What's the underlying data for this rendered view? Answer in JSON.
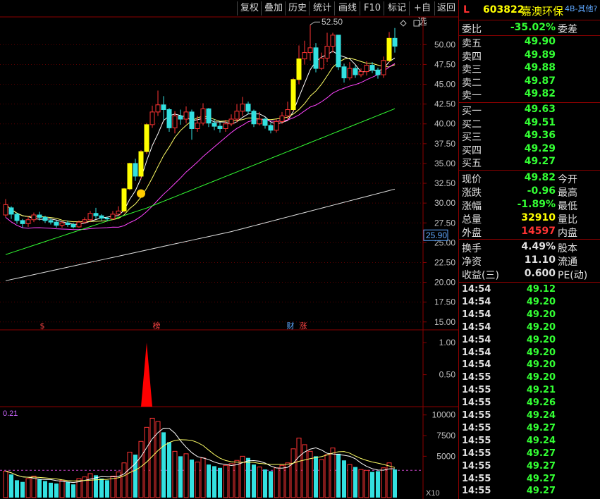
{
  "toolbar": {
    "buttons": [
      "复权",
      "叠加",
      "历史",
      "统计",
      "画线",
      "F10",
      "标记",
      "+自选",
      "返回"
    ]
  },
  "quote_header": {
    "flag": "L",
    "code": "603822",
    "name": "嘉澳环保",
    "other": "4B-其他?"
  },
  "order_book": {
    "weibi_label": "委比",
    "weibi_value": "-35.02%",
    "weicha_label": "委差",
    "asks": [
      {
        "label": "卖五",
        "price": "49.90"
      },
      {
        "label": "卖四",
        "price": "49.89"
      },
      {
        "label": "卖三",
        "price": "49.88"
      },
      {
        "label": "卖二",
        "price": "49.87"
      },
      {
        "label": "卖一",
        "price": "49.82"
      }
    ],
    "bids": [
      {
        "label": "买一",
        "price": "49.63"
      },
      {
        "label": "买二",
        "price": "49.51"
      },
      {
        "label": "买三",
        "price": "49.36"
      },
      {
        "label": "买四",
        "price": "49.29"
      },
      {
        "label": "买五",
        "price": "49.27"
      }
    ]
  },
  "stats": [
    {
      "label": "现价",
      "value": "49.82",
      "color": "#33ff33",
      "label2": "今开"
    },
    {
      "label": "涨跌",
      "value": "-0.96",
      "color": "#33ff33",
      "label2": "最高"
    },
    {
      "label": "涨幅",
      "value": "-1.89%",
      "color": "#33ff33",
      "label2": "最低"
    },
    {
      "label": "总量",
      "value": "32910",
      "color": "#ffff00",
      "label2": "量比"
    },
    {
      "label": "外盘",
      "value": "14597",
      "color": "#ff3333",
      "label2": "内盘"
    }
  ],
  "finance": [
    {
      "label": "换手",
      "value": "4.49%",
      "label2": "股本"
    },
    {
      "label": "净资",
      "value": "11.10",
      "label2": "流通"
    },
    {
      "label": "收益(三)",
      "value": "0.600",
      "label2": "PE(动)"
    }
  ],
  "ticks": [
    {
      "time": "14:54",
      "price": "49.12"
    },
    {
      "time": "14:54",
      "price": "49.20"
    },
    {
      "time": "14:54",
      "price": "49.20"
    },
    {
      "time": "14:54",
      "price": "49.20"
    },
    {
      "time": "14:54",
      "price": "49.20"
    },
    {
      "time": "14:54",
      "price": "49.20"
    },
    {
      "time": "14:54",
      "price": "49.20"
    },
    {
      "time": "14:55",
      "price": "49.20"
    },
    {
      "time": "14:55",
      "price": "49.21"
    },
    {
      "time": "14:55",
      "price": "49.26"
    },
    {
      "time": "14:55",
      "price": "49.24"
    },
    {
      "time": "14:55",
      "price": "49.27"
    },
    {
      "time": "14:55",
      "price": "49.24"
    },
    {
      "time": "14:55",
      "price": "49.27"
    },
    {
      "time": "14:55",
      "price": "49.27"
    },
    {
      "time": "14:55",
      "price": "49.27"
    },
    {
      "time": "14:55",
      "price": "49.27"
    }
  ],
  "chart_data": [
    {
      "type": "candlestick",
      "y_ticks": [
        "50.00",
        "47.50",
        "45.00",
        "42.50",
        "40.00",
        "37.50",
        "35.00",
        "32.50",
        "30.00",
        "27.50",
        "25.00",
        "22.50",
        "20.00",
        "17.50",
        "15.00"
      ],
      "ylim": [
        14.0,
        53.5
      ],
      "high_label": "52.50",
      "last_price_tag": "25.90",
      "markers": [
        "$",
        "榜",
        "财",
        "涨"
      ],
      "candles": [
        [
          28.5,
          29.8,
          28.2,
          30.5
        ],
        [
          29.4,
          28.6,
          28.0,
          29.6
        ],
        [
          28.6,
          27.8,
          27.4,
          28.8
        ],
        [
          27.8,
          27.4,
          26.9,
          28.0
        ],
        [
          27.4,
          27.9,
          27.0,
          28.3
        ],
        [
          27.9,
          28.5,
          27.6,
          28.8
        ],
        [
          28.5,
          28.2,
          27.8,
          28.9
        ],
        [
          28.2,
          27.8,
          27.5,
          28.4
        ],
        [
          27.8,
          27.6,
          27.3,
          28.0
        ],
        [
          27.6,
          27.2,
          26.9,
          27.8
        ],
        [
          27.2,
          27.5,
          26.9,
          27.7
        ],
        [
          27.5,
          27.3,
          27.0,
          27.8
        ],
        [
          27.3,
          27.0,
          26.8,
          27.5
        ],
        [
          27.0,
          27.6,
          26.9,
          27.8
        ],
        [
          27.6,
          27.9,
          27.4,
          28.2
        ],
        [
          27.9,
          28.7,
          27.7,
          29.0
        ],
        [
          28.7,
          28.4,
          28.0,
          29.4
        ],
        [
          28.4,
          28.1,
          27.8,
          28.6
        ],
        [
          28.1,
          28.0,
          27.7,
          28.3
        ],
        [
          28.0,
          28.6,
          27.9,
          29.0
        ],
        [
          28.6,
          29.0,
          28.4,
          29.6
        ],
        [
          29.0,
          31.8,
          28.8,
          31.9
        ],
        [
          31.8,
          35.0,
          31.6,
          35.1
        ],
        [
          35.0,
          33.4,
          32.8,
          35.6
        ],
        [
          33.4,
          36.5,
          33.0,
          36.7
        ],
        [
          36.5,
          39.9,
          36.2,
          40.1
        ],
        [
          39.9,
          41.5,
          39.5,
          42.3
        ],
        [
          41.5,
          42.4,
          41.0,
          44.2
        ],
        [
          42.4,
          41.8,
          40.5,
          43.5
        ],
        [
          41.8,
          39.5,
          39.0,
          42.0
        ],
        [
          39.5,
          41.0,
          38.8,
          41.6
        ],
        [
          41.0,
          40.6,
          39.9,
          41.8
        ],
        [
          40.6,
          41.5,
          40.1,
          42.2
        ],
        [
          41.5,
          39.4,
          38.0,
          41.8
        ],
        [
          39.4,
          40.1,
          39.0,
          41.0
        ],
        [
          40.1,
          41.9,
          39.8,
          42.6
        ],
        [
          41.9,
          40.1,
          39.6,
          42.0
        ],
        [
          40.1,
          39.7,
          39.2,
          40.6
        ],
        [
          39.7,
          39.4,
          38.9,
          40.2
        ],
        [
          39.4,
          40.0,
          39.0,
          40.5
        ],
        [
          40.0,
          40.6,
          39.7,
          41.2
        ],
        [
          40.6,
          41.6,
          40.2,
          42.5
        ],
        [
          41.6,
          42.5,
          41.0,
          43.4
        ],
        [
          42.5,
          41.6,
          41.2,
          42.8
        ],
        [
          41.6,
          40.0,
          39.6,
          41.8
        ],
        [
          40.0,
          40.6,
          39.8,
          41.5
        ],
        [
          40.6,
          39.8,
          39.4,
          40.8
        ],
        [
          39.8,
          39.2,
          38.8,
          40.1
        ],
        [
          39.2,
          40.3,
          38.9,
          40.6
        ],
        [
          40.3,
          41.0,
          40.0,
          41.5
        ],
        [
          41.0,
          41.8,
          40.5,
          42.8
        ],
        [
          41.8,
          45.6,
          41.6,
          45.8
        ],
        [
          45.6,
          48.2,
          45.0,
          49.9
        ],
        [
          48.2,
          49.0,
          47.5,
          50.5
        ],
        [
          49.0,
          49.6,
          48.0,
          52.5
        ],
        [
          49.6,
          47.0,
          46.5,
          50.2
        ],
        [
          47.0,
          48.3,
          46.8,
          49.0
        ],
        [
          48.3,
          49.8,
          47.8,
          51.5
        ],
        [
          49.8,
          51.2,
          49.0,
          51.5
        ],
        [
          51.2,
          47.2,
          46.8,
          51.0
        ],
        [
          47.2,
          45.8,
          45.2,
          47.6
        ],
        [
          45.8,
          47.0,
          45.5,
          47.8
        ],
        [
          47.0,
          46.2,
          45.8,
          47.4
        ],
        [
          46.2,
          46.6,
          45.9,
          47.0
        ],
        [
          46.6,
          47.4,
          46.1,
          47.9
        ],
        [
          47.4,
          46.8,
          46.4,
          47.8
        ],
        [
          46.8,
          46.2,
          45.7,
          47.1
        ],
        [
          46.2,
          48.0,
          45.8,
          48.5
        ],
        [
          48.0,
          50.8,
          47.8,
          51.6
        ],
        [
          50.8,
          49.8,
          49.0,
          52.1
        ]
      ]
    },
    {
      "type": "bar",
      "y_ticks": [
        "1.00",
        "0.50"
      ],
      "ylim": [
        0,
        1.2
      ]
    },
    {
      "type": "bar",
      "label": "0.21",
      "y_ticks": [
        "10000",
        "7500",
        "5000"
      ],
      "unit": "X10",
      "ylim": [
        0,
        11000
      ],
      "values": [
        3200,
        2800,
        2100,
        1900,
        2300,
        2600,
        2200,
        2000,
        1800,
        1700,
        2100,
        1900,
        1600,
        2300,
        2500,
        2900,
        2700,
        2300,
        2100,
        2600,
        3100,
        4200,
        5500,
        5200,
        6800,
        8500,
        9600,
        9200,
        7900,
        6700,
        5600,
        5000,
        5300,
        4600,
        4300,
        4800,
        4000,
        3800,
        3600,
        3900,
        4100,
        4500,
        5000,
        4800,
        4000,
        3700,
        3400,
        3200,
        3600,
        3900,
        4200,
        5900,
        7200,
        6400,
        5600,
        5000,
        4600,
        5200,
        6000,
        5300,
        4500,
        4000,
        3700,
        3400,
        3300,
        3100,
        3200,
        3600,
        4200,
        3400
      ],
      "colors": [
        "#ff3333",
        "#33e0e0"
      ]
    }
  ]
}
